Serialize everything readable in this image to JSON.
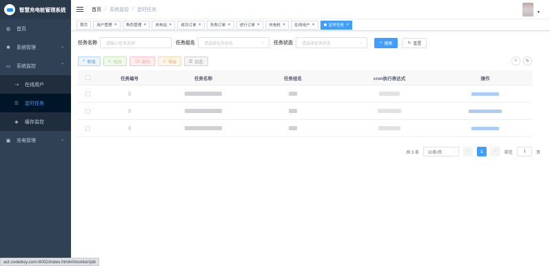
{
  "app": {
    "title": "智慧充电桩管理系统"
  },
  "sidebar": {
    "items": [
      {
        "label": "首页",
        "icon": "dashboard-icon"
      },
      {
        "label": "系统管理",
        "icon": "gear-icon"
      },
      {
        "label": "系统监控",
        "icon": "monitor-icon"
      },
      {
        "label": "充电管理",
        "icon": "charge-icon"
      }
    ],
    "submenu": [
      {
        "label": "在线用户",
        "icon": "online-icon"
      },
      {
        "label": "定时任务",
        "icon": "job-icon"
      },
      {
        "label": "缓存监控",
        "icon": "redis-icon"
      }
    ]
  },
  "breadcrumb": {
    "home": "首页",
    "mid": "系统监控",
    "last": "定时任务"
  },
  "tags": [
    "首页",
    "用户管理",
    "角色管理",
    "充电站",
    "成功订单",
    "失败订单",
    "进行订单",
    "充电桩",
    "在线用户",
    "定时任务"
  ],
  "search": {
    "name_label": "任务名称",
    "name_placeholder": "请输入任务名称",
    "group_label": "任务组名",
    "group_placeholder": "请选择任务组名",
    "status_label": "任务状态",
    "status_placeholder": "请选择任务状态",
    "search_btn": "搜索",
    "reset_btn": "重置"
  },
  "actions": {
    "add": "新增",
    "edit": "修改",
    "delete": "删除",
    "export": "导出",
    "log": "日志"
  },
  "table": {
    "headers": {
      "id": "任务编号",
      "name": "任务名称",
      "group": "任务组名",
      "cron": "cron执行表达式",
      "op": "操作"
    }
  },
  "pagination": {
    "total": "共 3 条",
    "page_size": "10条/页",
    "current": "1",
    "goto": "前往",
    "goto_val": "1",
    "page_unit": "页"
  },
  "statusbar": {
    "url": "act.codeboy.com:6002/index.html#/monitor/job"
  },
  "colors": {
    "primary": "#409eff",
    "sidebar": "#304156"
  }
}
